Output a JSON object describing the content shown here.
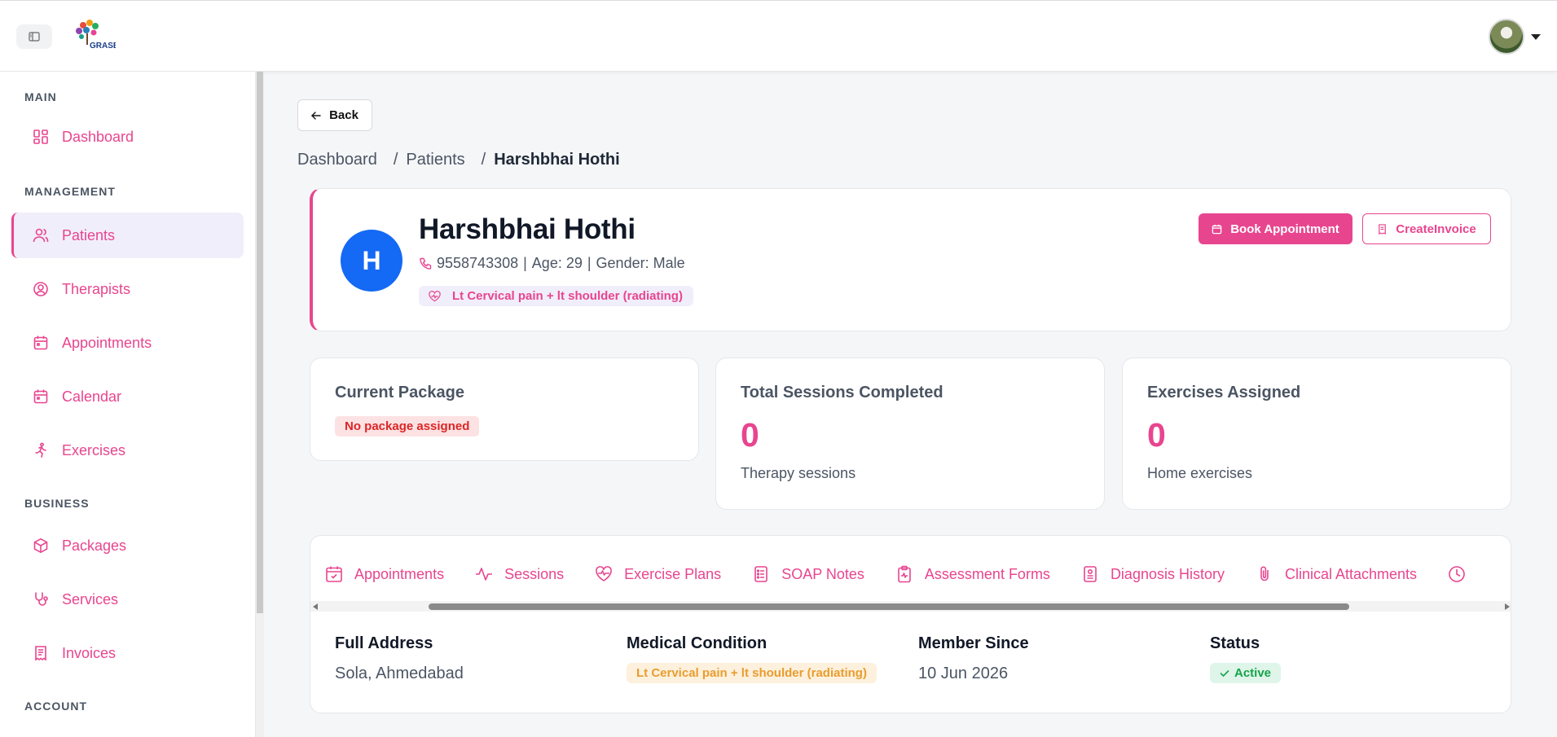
{
  "header": {
    "logo_text": "GRASE",
    "accent_color": "#e8458f"
  },
  "sidebar": {
    "sections": {
      "main": "MAIN",
      "management": "MANAGEMENT",
      "business": "BUSINESS",
      "account": "ACCOUNT"
    },
    "items": [
      {
        "label": "Dashboard",
        "icon": "grid-icon"
      },
      {
        "label": "Patients",
        "icon": "users-icon",
        "active": true
      },
      {
        "label": "Therapists",
        "icon": "user-circle-icon"
      },
      {
        "label": "Appointments",
        "icon": "calendar-icon"
      },
      {
        "label": "Calendar",
        "icon": "calendar-icon"
      },
      {
        "label": "Exercises",
        "icon": "running-icon"
      },
      {
        "label": "Packages",
        "icon": "box-icon"
      },
      {
        "label": "Services",
        "icon": "stethoscope-icon"
      },
      {
        "label": "Invoices",
        "icon": "receipt-icon"
      }
    ]
  },
  "main": {
    "back_label": "Back",
    "breadcrumb": {
      "home": "Dashboard",
      "section": "Patients",
      "current": "Harshbhai Hothi",
      "separator": "/"
    },
    "patient": {
      "initial": "H",
      "name": "Harshbhai Hothi",
      "phone": "9558743308",
      "age": "Age: 29",
      "gender": "Gender: Male",
      "condition": "Lt Cervical pain + lt shoulder (radiating)"
    },
    "actions": {
      "book": "Book Appointment",
      "invoice": "CreateInvoice"
    },
    "stats": {
      "package": {
        "title": "Current Package",
        "badge": "No package assigned"
      },
      "sessions": {
        "title": "Total Sessions Completed",
        "value": "0",
        "sub": "Therapy sessions"
      },
      "exercises": {
        "title": "Exercises Assigned",
        "value": "0",
        "sub": "Home exercises"
      }
    },
    "tabs": [
      {
        "label": "Appointments",
        "icon": "calendar-check-icon"
      },
      {
        "label": "Sessions",
        "icon": "activity-icon"
      },
      {
        "label": "Exercise Plans",
        "icon": "heart-pulse-icon"
      },
      {
        "label": "SOAP Notes",
        "icon": "notes-icon"
      },
      {
        "label": "Assessment Forms",
        "icon": "clipboard-icon"
      },
      {
        "label": "Diagnosis History",
        "icon": "file-icon"
      },
      {
        "label": "Clinical Attachments",
        "icon": "paperclip-icon"
      }
    ],
    "info": {
      "address_label": "Full Address",
      "address": "Sola, Ahmedabad",
      "condition_label": "Medical Condition",
      "condition": "Lt Cervical pain + lt shoulder (radiating)",
      "member_label": "Member Since",
      "member_since": "10 Jun 2026",
      "status_label": "Status",
      "status": "Active"
    }
  }
}
